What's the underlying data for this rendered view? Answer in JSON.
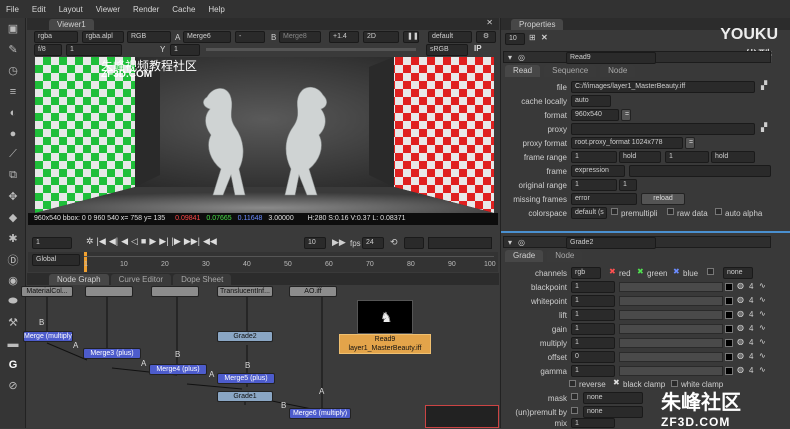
{
  "menu": [
    "File",
    "Edit",
    "Layout",
    "Viewer",
    "Render",
    "Cache",
    "Help"
  ],
  "viewer": {
    "tab": "Viewer1",
    "channels": "rgba",
    "alpha": "rgba.alpl",
    "display": "RGB",
    "a_label": "A",
    "a_input": "Merge6",
    "wipe": "-",
    "b_label": "B",
    "b_input": "Merge8",
    "zoom": "+1.4",
    "mode": "2D",
    "lut": "default",
    "fstop": "f/8",
    "frame": "1",
    "y_label": "Y",
    "y_value": "1",
    "srgb": "sRGB",
    "status_a": "960x540  bbox: 0 0 960 540  x= 758 y= 135",
    "status_r": "0.09841",
    "status_g": "0.07665",
    "status_b": "0.11648",
    "status_a_val": "3.00000",
    "status_hsv": "H:280 S:0.16 V:0.37  L: 0.08371",
    "watermark1": "朱峰视频教程社区",
    "watermark2": "ZF3D.COM"
  },
  "playback": {
    "frame": "1",
    "increment": "10",
    "fps_label": "fps",
    "fps": "24",
    "range_mode": "Global",
    "ticks": [
      "1",
      "10",
      "20",
      "30",
      "40",
      "50",
      "60",
      "70",
      "80",
      "90",
      "100"
    ]
  },
  "nodegraph": {
    "tabs": [
      "Node Graph",
      "Curve Editor",
      "Dope Sheet"
    ],
    "nodes": {
      "m_multiply": "Merge (multiply)",
      "merge3": "Merge3 (plus)",
      "merge4": "Merge4 (plus)",
      "merge5": "Merge5 (plus)",
      "merge6": "Merge6 (multiply)",
      "grade2": "Grade2",
      "grade1": "Grade1",
      "read9_name": "Read9",
      "read9_file": "layer1_MasterBeauty.iff",
      "top1": "MaterialCol...",
      "top2": "TranslucentInf...",
      "top3": "AO.iff"
    },
    "labels": {
      "a": "A",
      "b": "B"
    }
  },
  "properties": {
    "title": "Properties",
    "count": "10",
    "brand1": "YOUKU",
    "brand2": "优酷",
    "read": {
      "name": "Read9",
      "tabs": [
        "Read",
        "Sequence",
        "Node"
      ],
      "file_label": "file",
      "file": "C:/f/images/layer1_MasterBeauty.iff",
      "cache_label": "cache locally",
      "cache": "auto",
      "format_label": "format",
      "format": "960x540",
      "proxy_label": "proxy",
      "proxy_format_label": "proxy format",
      "proxy_format": "root.proxy_format 1024x778",
      "frame_range_label": "frame range",
      "frame_start": "1",
      "frame_start_mode": "hold",
      "frame_end": "1",
      "frame_end_mode": "hold",
      "frame_label": "frame",
      "frame_mode": "expression",
      "orig_range_label": "original range",
      "orig_start": "1",
      "orig_end": "1",
      "missing_label": "missing frames",
      "missing": "error",
      "reload": "reload",
      "colorspace_label": "colorspace",
      "colorspace": "default (s",
      "premult": "premultipli",
      "raw": "raw data",
      "autoalpha": "auto alpha"
    },
    "grade": {
      "name": "Grade2",
      "tabs": [
        "Grade",
        "Node"
      ],
      "channels_label": "channels",
      "channels": "rgb",
      "red": "red",
      "green": "green",
      "blue": "blue",
      "none": "none",
      "rows": [
        {
          "label": "blackpoint",
          "value": "1"
        },
        {
          "label": "whitepoint",
          "value": "1"
        },
        {
          "label": "lift",
          "value": "1"
        },
        {
          "label": "gain",
          "value": "1"
        },
        {
          "label": "multiply",
          "value": "1"
        },
        {
          "label": "offset",
          "value": "0"
        },
        {
          "label": "gamma",
          "value": "1"
        }
      ],
      "reverse": "reverse",
      "black_clamp": "black clamp",
      "white_clamp": "white clamp",
      "mask_label": "mask",
      "mask": "none",
      "unpremult_label": "(un)premult by",
      "unpremult": "none",
      "mix_label": "mix",
      "mix": "1"
    }
  },
  "watermark_bottom": {
    "line1": "朱峰社区",
    "line2": "ZF3D.COM"
  },
  "colors": {
    "accent": "#f0a030",
    "merge": "#4d5ccc",
    "grade": "#8aa6c4"
  }
}
